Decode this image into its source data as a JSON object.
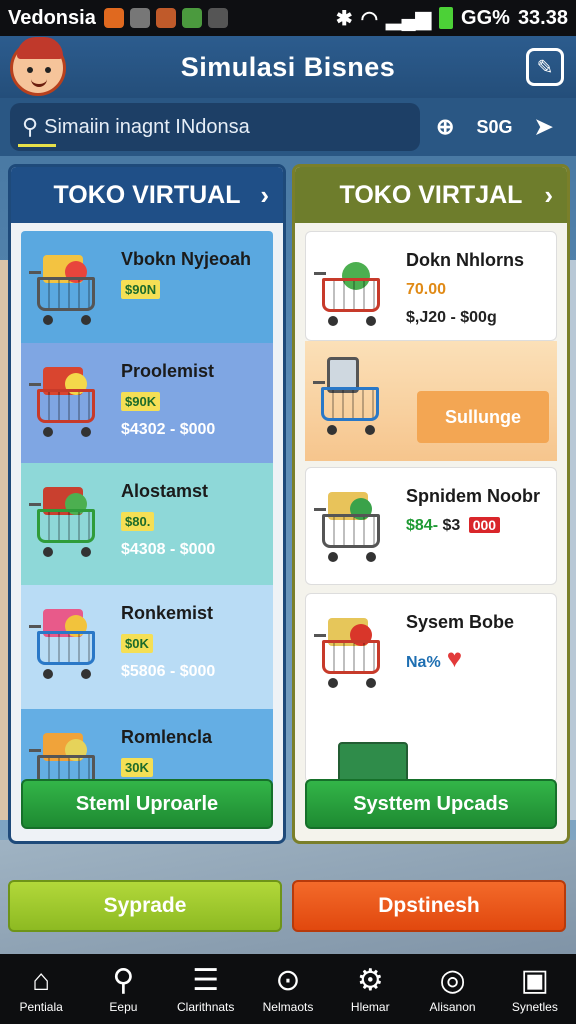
{
  "status_bar": {
    "carrier": "Vedonsia",
    "battery_text": "GG%",
    "time": "33.38"
  },
  "header": {
    "title": "Simulasi  Bisnes",
    "edit_icon": "edit-icon"
  },
  "search": {
    "text": "Simaiin inagnt INdonsa",
    "tool_label": "S0G"
  },
  "left_column": {
    "title": "TOKO VIRTUAL",
    "items": [
      {
        "name": "Vbokn Nyjeoah",
        "price": "$90N",
        "range": ""
      },
      {
        "name": "Proolemist",
        "price": "$90K",
        "range": "$4302 - $000"
      },
      {
        "name": "Alostamst",
        "price": "$80.",
        "range": "$4308 - $000"
      },
      {
        "name": "Ronkemist",
        "price": "$0K",
        "range": "$5806 - $000"
      },
      {
        "name": "Romlencla",
        "price": "30K",
        "range": ""
      }
    ],
    "upgrade_label": "Steml Uproarle"
  },
  "right_column": {
    "title": "TOKO VIRTJAL",
    "items": [
      {
        "name": "Dokn Nhlorns",
        "price": "70.00",
        "range": "$,J20 - $00g"
      },
      {
        "name": "",
        "price": "",
        "range": "",
        "button": "Sullunge"
      },
      {
        "name": "Spnidem Noobr",
        "price": "",
        "range_green": "$84-",
        "range": "$3",
        "tag": "000"
      },
      {
        "name": "Sysem Bobe",
        "price": "",
        "range": "Na%"
      }
    ],
    "upgrade_label": "Systtem Upcads"
  },
  "actions": {
    "left": "Syprade",
    "right": "Dpstinesh"
  },
  "bottom_nav": [
    {
      "icon": "home-icon",
      "glyph": "⌂",
      "label": "Pentiala"
    },
    {
      "icon": "location-pin-icon",
      "glyph": "⚲",
      "label": "Eepu"
    },
    {
      "icon": "list-icon",
      "glyph": "☰",
      "label": "Clarithnats"
    },
    {
      "icon": "marker-icon",
      "glyph": "⊙",
      "label": "Nelmaots"
    },
    {
      "icon": "gear-icon",
      "glyph": "⚙",
      "label": "Hlemar"
    },
    {
      "icon": "circle-icon",
      "glyph": "◎",
      "label": "Alisanon"
    },
    {
      "icon": "calendar-icon",
      "glyph": "▣",
      "label": "Synetles"
    }
  ],
  "colors": {
    "left_header": "#1f4f87",
    "right_header": "#6e7d2c",
    "upgrade_green": "#33b548",
    "action_green": "#b2d83a",
    "action_orange": "#f36a2a"
  }
}
